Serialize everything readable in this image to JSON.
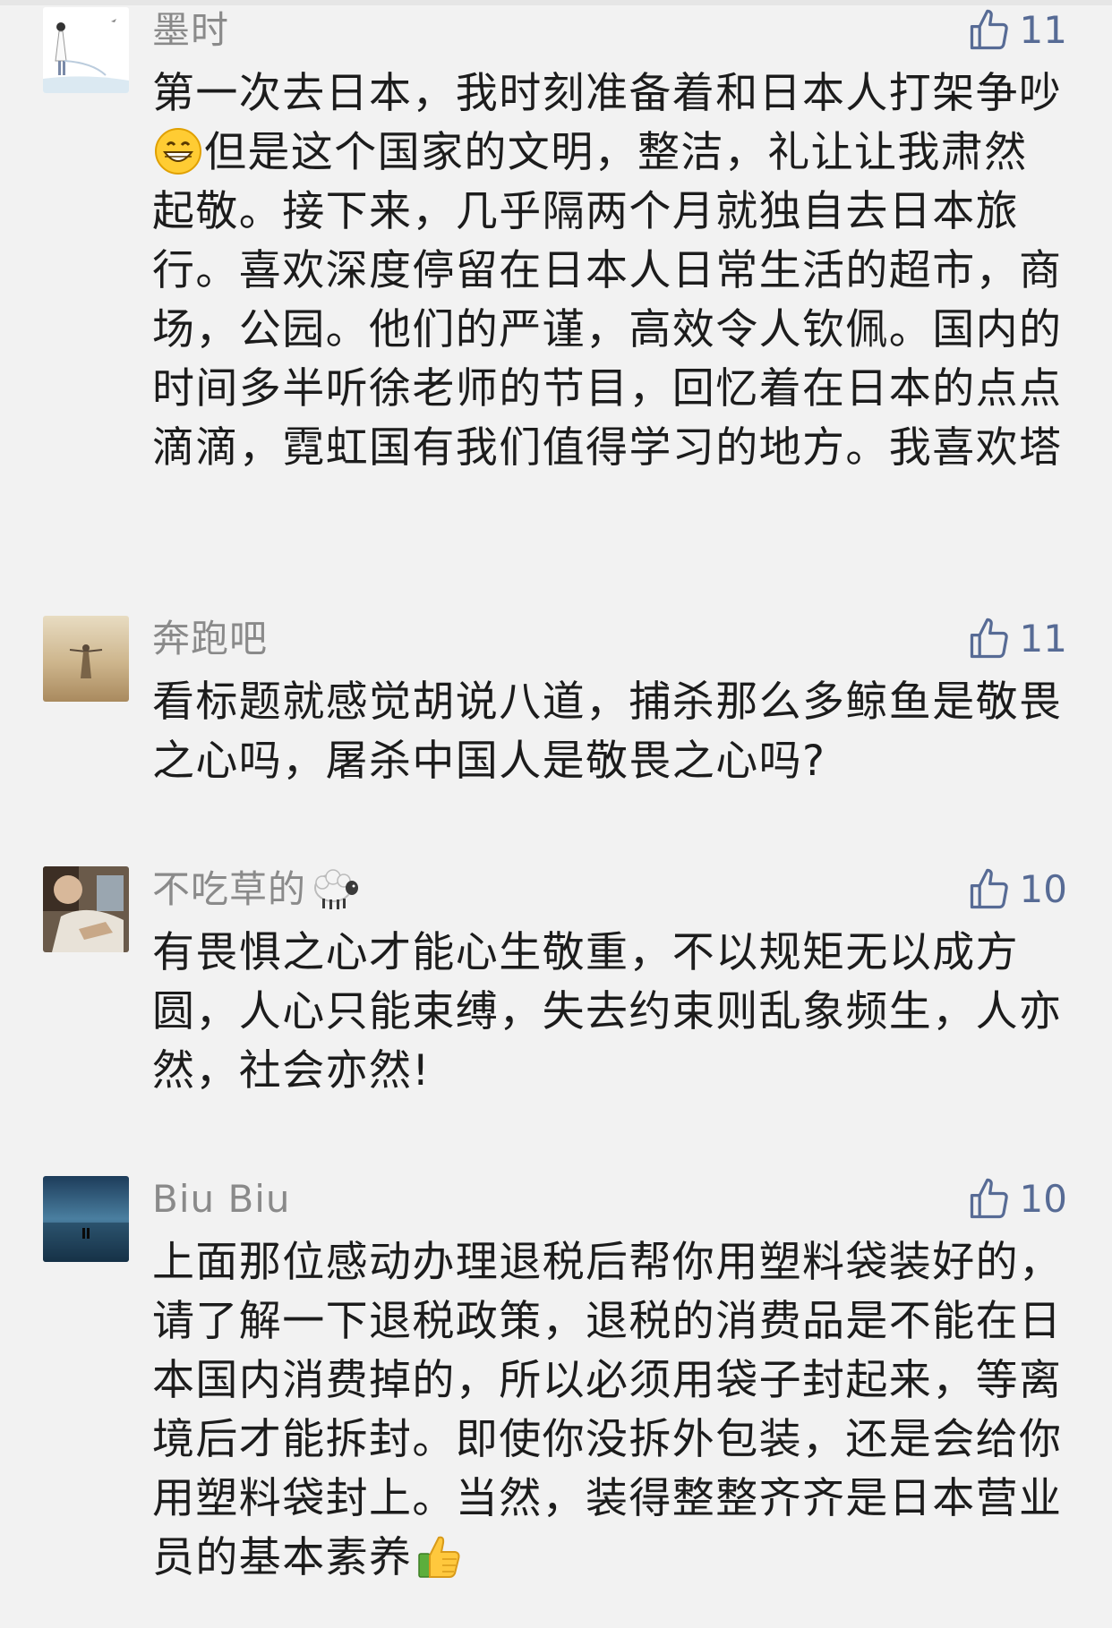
{
  "comments": [
    {
      "user": "墨时",
      "likes": "11",
      "text_a": "第一次去日本，我时刻准备着和日本人打架争吵",
      "emoji_1": "grinning-face-emoji",
      "text_b": "但是这个国家的文明，整洁，礼让让我肃然起敬。接下来，几乎隔两个月就独自去日本旅行。喜欢深度停留在日本人日常生活的超市，商场，公园。他们的严谨，高效令人钦佩。国内的时间多半听徐老师的节目，回忆着在日本的点点滴滴，霓虹国有我们值得学习的地方。我喜欢塔"
    },
    {
      "user": "奔跑吧",
      "likes": "11",
      "text": "看标题就感觉胡说八道，捕杀那么多鲸鱼是敬畏之心吗，屠杀中国人是敬畏之心吗?"
    },
    {
      "user": "不吃草的",
      "user_emoji": "sheep-emoji",
      "likes": "10",
      "text": "有畏惧之心才能心生敬重，不以规矩无以成方圆，人心只能束缚，失去约束则乱象频生，人亦然，社会亦然!"
    },
    {
      "user": "Biu Biu",
      "likes": "10",
      "text_a": "上面那位感动办理退税后帮你用塑料袋装好的，请了解一下退税政策，退税的消费品是不能在日本国内消费掉的，所以必须用袋子封起来，等离境后才能拆封。即使你没拆外包装，还是会给你用塑料袋封上。当然，装得整整齐齐是日本营业员的基本素养",
      "emoji_2": "thumbs-up-emoji"
    }
  ],
  "colors": {
    "background": "#f2f2f2",
    "name": "#8a8a8a",
    "like": "#576b95",
    "text": "#1c1c1c"
  }
}
